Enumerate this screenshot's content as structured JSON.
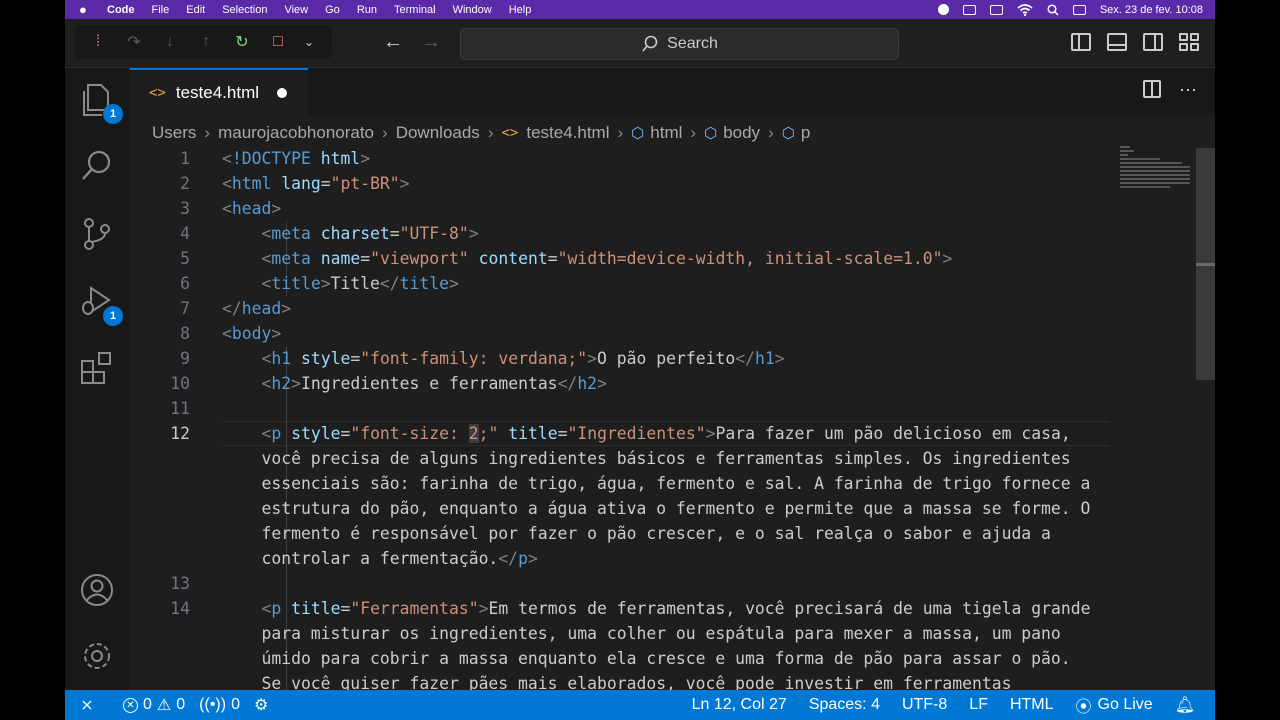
{
  "menubar": {
    "apple": "",
    "items": [
      "Code",
      "File",
      "Edit",
      "Selection",
      "View",
      "Go",
      "Run",
      "Terminal",
      "Window",
      "Help"
    ],
    "datetime": "Sex. 23 de fev.  10:08"
  },
  "titlebar": {
    "search_placeholder": "Search"
  },
  "activity": {
    "explorer_badge": "1",
    "debug_badge": "1"
  },
  "tab": {
    "filename": "teste4.html"
  },
  "breadcrumb": [
    "Users",
    "maurojacobhonorato",
    "Downloads",
    "teste4.html",
    "html",
    "body",
    "p"
  ],
  "editor": {
    "line_numbers": [
      "1",
      "2",
      "3",
      "4",
      "5",
      "6",
      "7",
      "8",
      "9",
      "10",
      "11",
      "12",
      "13",
      "14"
    ],
    "active_line": "12"
  },
  "status": {
    "errors": "0",
    "warnings": "0",
    "ports": "0",
    "position": "Ln 12, Col 27",
    "indent": "Spaces: 4",
    "encoding": "UTF-8",
    "eol": "LF",
    "language": "HTML",
    "golive": "Go Live"
  },
  "colors": {
    "accent": "#0078d4",
    "menubar": "#5a2aa8",
    "editor_bg": "#1e1e1e"
  }
}
